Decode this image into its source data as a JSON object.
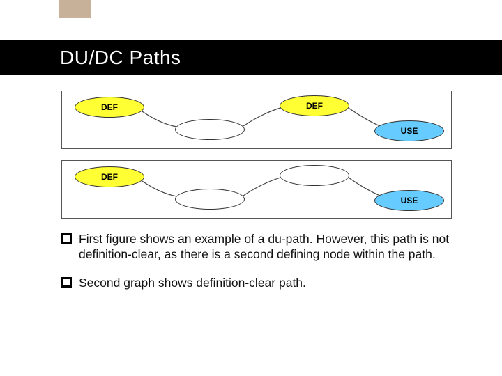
{
  "title": "DU/DC Paths",
  "labels": {
    "def": "DEF",
    "use": "USE"
  },
  "bullets": [
    "First figure shows an example of a du-path. However, this path is not definition-clear, as there is a second defining node within the path.",
    "Second graph shows definition-clear path."
  ]
}
